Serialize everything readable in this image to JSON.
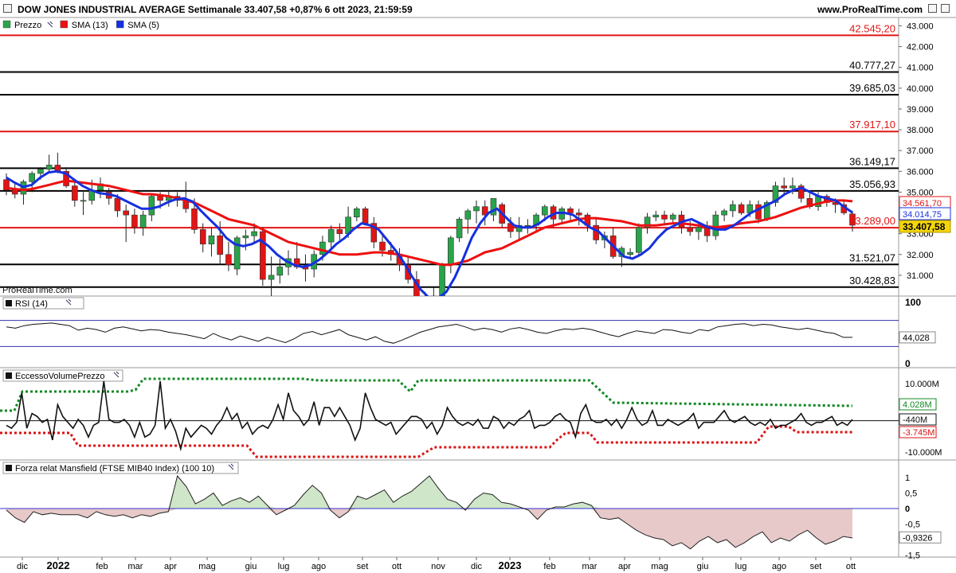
{
  "header": {
    "title": "DOW JONES INDUSTRIAL AVERAGE Settimanale 33.407,58 +0,87% 6 ott 2023, 21:59:59",
    "brand": "www.ProRealTime.com"
  },
  "colors": {
    "up": "#2aa34a",
    "down": "#e01515",
    "sma13": "#ee1010",
    "sma5": "#1530e0",
    "level_red": "#e01515",
    "level_black": "#000000",
    "rsi_band": "#3333aa",
    "evp_green": "#118822",
    "evp_red": "#dd1111",
    "mansfield_pos": "#cfe6c8",
    "mansfield_neg": "#e8c9c9",
    "zero_line": "#3333cc"
  },
  "price_panel": {
    "legend": [
      {
        "label": "Prezzo",
        "color": "#2aa34a"
      },
      {
        "label": "SMA (13)",
        "color": "#ee1010"
      },
      {
        "label": "SMA (5)",
        "color": "#1530e0"
      }
    ],
    "watermark": "ProRealTime.com",
    "y_ticks": [
      "43.000",
      "42.000",
      "41.000",
      "40.000",
      "39.000",
      "38.000",
      "37.000",
      "36.000",
      "35.000",
      "34.000",
      "33.000",
      "32.000",
      "31.000"
    ],
    "level_lines": [
      {
        "label": "42.545,20",
        "value": 42545.2,
        "color": "red"
      },
      {
        "label": "40.777,27",
        "value": 40777.27,
        "color": "black"
      },
      {
        "label": "39.685,03",
        "value": 39685.03,
        "color": "black"
      },
      {
        "label": "37.917,10",
        "value": 37917.1,
        "color": "red"
      },
      {
        "label": "36.149,17",
        "value": 36149.17,
        "color": "black"
      },
      {
        "label": "35.056,93",
        "value": 35056.93,
        "color": "black"
      },
      {
        "label": "33.289,00",
        "value": 33289.0,
        "color": "red"
      },
      {
        "label": "31.521,07",
        "value": 31521.07,
        "color": "black"
      },
      {
        "label": "30.428,83",
        "value": 30428.83,
        "color": "black"
      }
    ],
    "price_tags": [
      {
        "label": "34.561,70",
        "value": 34561.7,
        "color": "red"
      },
      {
        "label": "34.014,75",
        "value": 34014.75,
        "color": "blue"
      },
      {
        "label": "33.407,58",
        "value": 33407.58,
        "color": "yellow"
      }
    ]
  },
  "rsi_panel": {
    "label": "RSI (14)",
    "top_tick": "100",
    "bottom_tick": "0",
    "value_tag": "44,028",
    "series": [
      60,
      58,
      62,
      64,
      65,
      66,
      64,
      62,
      55,
      58,
      56,
      52,
      58,
      60,
      57,
      54,
      56,
      55,
      52,
      50,
      48,
      45,
      42,
      50,
      44,
      40,
      46,
      42,
      38,
      44,
      40,
      36,
      42,
      50,
      53,
      48,
      52,
      56,
      48,
      44,
      40,
      45,
      38,
      35,
      40,
      46,
      52,
      56,
      60,
      62,
      64,
      60,
      55,
      58,
      56,
      52,
      57,
      59,
      56,
      52,
      50,
      54,
      57,
      56,
      58,
      56,
      52,
      48,
      45,
      50,
      54,
      52,
      50,
      56,
      55,
      52,
      50,
      56,
      54,
      60,
      62,
      64,
      65,
      62,
      64,
      63,
      60,
      58,
      56,
      58,
      55,
      52,
      50,
      44,
      44
    ]
  },
  "evp_panel": {
    "label": "EccessoVolumePrezzo",
    "ticks": [
      "10.000M",
      "-10.000M"
    ],
    "value_tags": [
      {
        "label": "4.028M",
        "color": "green"
      },
      {
        "label": "-440M",
        "color": "black"
      },
      {
        "label": "-3.745M",
        "color": "red"
      }
    ],
    "series": [
      -2,
      -3,
      -1,
      9,
      -3,
      2,
      1,
      -1,
      0,
      -7,
      5,
      1,
      -1,
      -3,
      0,
      -2,
      -6,
      -2,
      -1,
      13,
      0,
      -1,
      -1,
      0,
      -2,
      -6,
      -1,
      -6,
      -5,
      -2,
      13,
      -3,
      0,
      -4,
      -10,
      -3,
      -6,
      -4,
      -2,
      -3,
      -5,
      -2,
      0,
      4,
      0,
      2,
      -3,
      -1,
      -5,
      -3,
      -2,
      -3,
      0,
      5,
      0,
      9,
      3,
      1,
      -2,
      0,
      6,
      -2,
      4,
      4,
      1,
      4,
      1,
      -2,
      -7,
      -3,
      9,
      4,
      0,
      -1,
      -2,
      -1,
      -5,
      -3,
      -1,
      1,
      1,
      0,
      -3,
      -1,
      -5,
      -2,
      4,
      1,
      -1,
      -2,
      -1,
      -2,
      0,
      -3,
      -3,
      1,
      0,
      -3,
      -1,
      -2,
      0,
      1,
      3,
      -3,
      -2,
      -2,
      -1,
      1,
      2,
      0,
      -1,
      -6,
      2,
      5,
      0,
      -1,
      -1,
      0,
      -2,
      0,
      -3,
      0,
      4,
      0,
      -2,
      -1,
      3,
      -2,
      -2,
      0,
      -1,
      -2,
      -1,
      0,
      2,
      -3,
      -1,
      -1,
      -1,
      1,
      3,
      0,
      -1,
      0,
      1,
      -1,
      -2,
      -1,
      -2,
      0,
      -3,
      -2,
      -2,
      -1,
      0,
      2,
      -1,
      -2,
      -1,
      -1,
      0,
      1,
      -2,
      -1,
      -2,
      0
    ]
  },
  "mansfield_panel": {
    "label": "Forza relat Mansfield (FTSE MIB40 Index) (100 10)",
    "ticks": [
      "1",
      "0,5",
      "0",
      "-0,5",
      "-1,5"
    ],
    "value_tag": "-0,9326",
    "series": [
      -0.05,
      -0.3,
      -0.45,
      -0.1,
      -0.2,
      -0.15,
      -0.2,
      -0.2,
      -0.2,
      -0.3,
      -0.1,
      -0.2,
      -0.25,
      -0.2,
      -0.3,
      -0.2,
      -0.25,
      -0.15,
      -0.1,
      1.05,
      0.7,
      0.15,
      0.3,
      0.5,
      0.1,
      0.25,
      0.35,
      0.2,
      0.4,
      0.1,
      -0.2,
      -0.05,
      0.1,
      0.45,
      0.75,
      0.5,
      -0.05,
      -0.3,
      -0.1,
      0.4,
      0.3,
      0.45,
      0.6,
      0.2,
      0.4,
      0.55,
      0.8,
      1.05,
      0.65,
      0.3,
      0.2,
      -0.05,
      0.3,
      0.5,
      0.45,
      0.2,
      0.15,
      0.05,
      -0.05,
      -0.35,
      -0.05,
      0.05,
      0.05,
      0.15,
      0.2,
      0.1,
      -0.3,
      -0.35,
      -0.3,
      -0.5,
      -0.7,
      -0.85,
      -0.95,
      -1.0,
      -1.2,
      -1.1,
      -1.3,
      -1.05,
      -0.9,
      -1.1,
      -1.0,
      -1.25,
      -1.1,
      -0.9,
      -0.75,
      -1.1,
      -0.95,
      -1.05,
      -0.85,
      -0.7,
      -0.95,
      -1.15,
      -1.05,
      -0.9,
      -0.95
    ]
  },
  "x_axis": {
    "ticks": [
      "dic",
      "2022",
      "feb",
      "mar",
      "apr",
      "mag",
      "giu",
      "lug",
      "ago",
      "set",
      "ott",
      "nov",
      "dic",
      "2023",
      "feb",
      "mar",
      "apr",
      "mag",
      "giu",
      "lug",
      "ago",
      "set",
      "ott"
    ]
  },
  "chart_data": {
    "type": "candlestick",
    "title": "DOW JONES INDUSTRIAL AVERAGE Settimanale",
    "timeframe": "weekly",
    "last_close": 33407.58,
    "ylim": [
      30000,
      43400
    ],
    "candles": [
      [
        35600,
        35900,
        34850,
        35100
      ],
      [
        35100,
        35500,
        34700,
        34900
      ],
      [
        34900,
        35600,
        34400,
        35500
      ],
      [
        35500,
        36000,
        35000,
        35900
      ],
      [
        35900,
        36200,
        35600,
        36100
      ],
      [
        36100,
        36800,
        35900,
        36300
      ],
      [
        36300,
        36900,
        35900,
        36000
      ],
      [
        36000,
        36200,
        35200,
        35300
      ],
      [
        35300,
        35500,
        34300,
        34600
      ],
      [
        34600,
        35000,
        33900,
        34600
      ],
      [
        34600,
        35600,
        34400,
        35100
      ],
      [
        35100,
        35700,
        34700,
        35400
      ],
      [
        35000,
        35200,
        34400,
        34700
      ],
      [
        34700,
        34900,
        33800,
        34100
      ],
      [
        34100,
        34400,
        32600,
        33900
      ],
      [
        33900,
        34200,
        33000,
        33300
      ],
      [
        33300,
        34100,
        32900,
        33900
      ],
      [
        33900,
        34900,
        33600,
        34800
      ],
      [
        34800,
        35000,
        34200,
        34600
      ],
      [
        34600,
        35100,
        34300,
        34800
      ],
      [
        34800,
        35000,
        34300,
        34600
      ],
      [
        34600,
        35500,
        34000,
        34200
      ],
      [
        34200,
        34700,
        33000,
        33200
      ],
      [
        33200,
        33500,
        32100,
        32500
      ],
      [
        32500,
        33300,
        31900,
        32900
      ],
      [
        32900,
        33600,
        31500,
        32000
      ],
      [
        32000,
        32600,
        31200,
        31500
      ],
      [
        31300,
        32900,
        31000,
        32800
      ],
      [
        32800,
        33200,
        32200,
        32900
      ],
      [
        32900,
        33500,
        32500,
        33100
      ],
      [
        33100,
        33300,
        30500,
        30800
      ],
      [
        30800,
        31900,
        29700,
        31000
      ],
      [
        31000,
        31800,
        30600,
        31400
      ],
      [
        31400,
        32200,
        31000,
        31800
      ],
      [
        31800,
        32600,
        31300,
        31400
      ],
      [
        31400,
        32000,
        30700,
        31300
      ],
      [
        31300,
        32200,
        30900,
        32000
      ],
      [
        32000,
        32900,
        31700,
        32600
      ],
      [
        32600,
        33400,
        32300,
        33200
      ],
      [
        33200,
        33500,
        32700,
        33000
      ],
      [
        33000,
        34300,
        32800,
        33800
      ],
      [
        33800,
        34300,
        33600,
        34200
      ],
      [
        34200,
        34300,
        33400,
        33500
      ],
      [
        33500,
        33800,
        32300,
        32600
      ],
      [
        32600,
        32900,
        31900,
        32200
      ],
      [
        32200,
        32600,
        31700,
        32000
      ],
      [
        32000,
        32300,
        31200,
        31500
      ],
      [
        31500,
        31900,
        30600,
        30800
      ],
      [
        30800,
        31200,
        29500,
        29700
      ],
      [
        29700,
        30200,
        29300,
        29600
      ],
      [
        29600,
        30400,
        29400,
        30000
      ],
      [
        30000,
        31600,
        29600,
        31500
      ],
      [
        31500,
        32900,
        31100,
        32800
      ],
      [
        32800,
        33800,
        32600,
        33700
      ],
      [
        33700,
        34200,
        33000,
        34100
      ],
      [
        34100,
        34600,
        33500,
        34300
      ],
      [
        34300,
        34600,
        33400,
        33900
      ],
      [
        33900,
        34700,
        33600,
        34700
      ],
      [
        34400,
        34500,
        33300,
        33500
      ],
      [
        33500,
        33800,
        32800,
        33100
      ],
      [
        33100,
        33800,
        32700,
        33400
      ],
      [
        33400,
        33700,
        33000,
        33400
      ],
      [
        33400,
        34000,
        33100,
        33900
      ],
      [
        33900,
        34400,
        33600,
        34300
      ],
      [
        34300,
        34400,
        33300,
        33700
      ],
      [
        33700,
        34300,
        33500,
        34200
      ],
      [
        34200,
        34300,
        33600,
        34000
      ],
      [
        34000,
        34200,
        33400,
        33900
      ],
      [
        33900,
        34000,
        33100,
        33400
      ],
      [
        33400,
        33800,
        32500,
        32700
      ],
      [
        32700,
        33100,
        32300,
        32900
      ],
      [
        32900,
        33300,
        31800,
        31900
      ],
      [
        31900,
        32400,
        31400,
        32300
      ],
      [
        32000,
        32300,
        31800,
        32100
      ],
      [
        32100,
        33500,
        31900,
        33300
      ],
      [
        33300,
        34000,
        33000,
        33800
      ],
      [
        33800,
        34100,
        33600,
        33900
      ],
      [
        33900,
        34100,
        33400,
        33700
      ],
      [
        33700,
        34000,
        33500,
        33900
      ],
      [
        33900,
        34100,
        33000,
        33300
      ],
      [
        33300,
        33600,
        32900,
        33100
      ],
      [
        33100,
        33500,
        32700,
        33300
      ],
      [
        33300,
        33600,
        32600,
        32900
      ],
      [
        32900,
        34100,
        32700,
        33900
      ],
      [
        33900,
        34200,
        33600,
        34100
      ],
      [
        34100,
        34600,
        33800,
        34400
      ],
      [
        34400,
        34500,
        33900,
        34000
      ],
      [
        34000,
        34600,
        33800,
        34400
      ],
      [
        34400,
        34600,
        33500,
        33700
      ],
      [
        33700,
        34600,
        33600,
        34500
      ],
      [
        34500,
        35500,
        34300,
        35300
      ],
      [
        35300,
        35700,
        34900,
        35200
      ],
      [
        35200,
        35700,
        34900,
        35300
      ],
      [
        35300,
        35400,
        34500,
        34700
      ],
      [
        34700,
        35000,
        34200,
        34300
      ],
      [
        34300,
        35000,
        34100,
        34800
      ],
      [
        34800,
        34900,
        34300,
        34500
      ],
      [
        34500,
        34700,
        34000,
        34400
      ],
      [
        34400,
        34600,
        33900,
        34000
      ],
      [
        33950,
        34100,
        33100,
        33407.58
      ]
    ],
    "sma13": [
      35200,
      35150,
      35100,
      35150,
      35250,
      35350,
      35450,
      35550,
      35500,
      35450,
      35400,
      35350,
      35300,
      35200,
      35100,
      35000,
      34900,
      34900,
      34850,
      34800,
      34700,
      34600,
      34500,
      34300,
      34100,
      33900,
      33700,
      33600,
      33500,
      33400,
      33200,
      33000,
      32800,
      32600,
      32500,
      32400,
      32300,
      32200,
      32100,
      32000,
      32000,
      32000,
      32050,
      32100,
      32100,
      32050,
      32000,
      31900,
      31800,
      31700,
      31600,
      31500,
      31500,
      31600,
      31700,
      31900,
      32100,
      32200,
      32300,
      32500,
      32700,
      32900,
      33100,
      33300,
      33400,
      33500,
      33600,
      33700,
      33750,
      33750,
      33700,
      33650,
      33600,
      33500,
      33400,
      33400,
      33400,
      33450,
      33500,
      33500,
      33450,
      33400,
      33350,
      33300,
      33350,
      33400,
      33500,
      33550,
      33600,
      33700,
      33800,
      33950,
      34100,
      34250,
      34350,
      34450,
      34550,
      34600,
      34600,
      34561.7
    ],
    "sma5": [
      35700,
      35450,
      35250,
      35350,
      35700,
      35950,
      36000,
      35900,
      35600,
      35300,
      35100,
      34950,
      34900,
      34800,
      34600,
      34400,
      34200,
      34200,
      34300,
      34500,
      34650,
      34700,
      34550,
      34100,
      33700,
      33300,
      32800,
      32500,
      32400,
      32500,
      32700,
      32400,
      32000,
      31700,
      31500,
      31400,
      31500,
      31750,
      32100,
      32500,
      32800,
      33200,
      33500,
      33400,
      33200,
      32700,
      32200,
      31600,
      30900,
      30300,
      29900,
      29900,
      30200,
      30900,
      31800,
      32800,
      33500,
      34000,
      34200,
      33800,
      33400,
      33300,
      33300,
      33500,
      33800,
      34000,
      34000,
      33900,
      33600,
      33300,
      33100,
      32700,
      32300,
      31900,
      31800,
      32000,
      32300,
      32800,
      33200,
      33400,
      33600,
      33700,
      33500,
      33300,
      33200,
      33200,
      33400,
      33700,
      34000,
      34200,
      34400,
      34600,
      34900,
      35100,
      35200,
      35000,
      34800,
      34700,
      34600,
      34300,
      34014.75
    ]
  }
}
